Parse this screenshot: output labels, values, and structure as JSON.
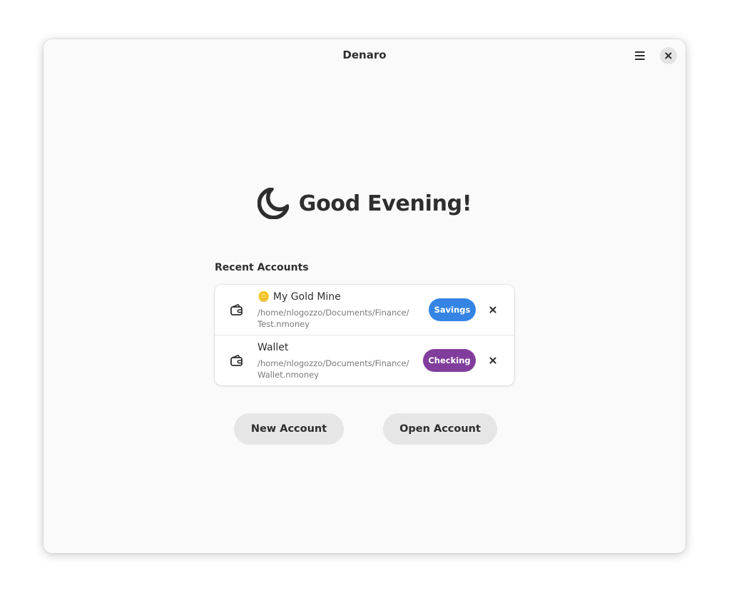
{
  "window": {
    "title": "Denaro",
    "menu_icon": "hamburger-menu-icon",
    "close_icon": "close-icon"
  },
  "greeting": {
    "icon": "moon-icon",
    "text": "Good Evening!"
  },
  "recent": {
    "title": "Recent Accounts",
    "accounts": [
      {
        "name": "🪙 My Gold Mine",
        "path_line1": "/home/nlogozzo/Documents/Finance/",
        "path_line2": "Test.nmoney",
        "type": "Savings",
        "type_color": "#3584e4",
        "icon": "wallet-icon"
      },
      {
        "name": "Wallet",
        "path_line1": "/home/nlogozzo/Documents/Finance/",
        "path_line2": "Wallet.nmoney",
        "type": "Checking",
        "type_color": "#813d9c",
        "icon": "wallet-icon"
      }
    ]
  },
  "actions": {
    "new_account": "New Account",
    "open_account": "Open Account"
  },
  "colors": {
    "window_bg": "#fafafa",
    "text": "#2e2e2e",
    "button_bg": "#e6e6e6",
    "savings": "#3584e4",
    "checking": "#813d9c"
  }
}
